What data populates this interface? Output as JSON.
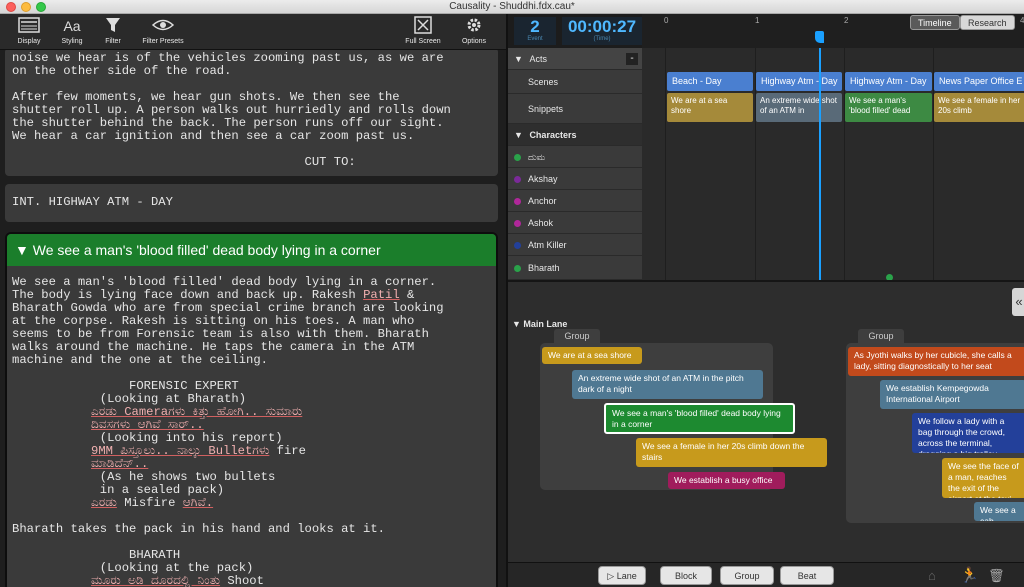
{
  "window": {
    "title": "Causality - Shuddhi.fdx.cau*"
  },
  "toolbar": {
    "display": "Display",
    "styling": "Styling",
    "styling_icon_glyph": "Aa",
    "filter": "Filter",
    "filter_presets": "Filter Presets",
    "full_screen": "Full Screen",
    "options": "Options"
  },
  "script": {
    "card1_lines": [
      "noise we hear is of the vehicles zooming past us, as we are",
      "on the other side of the road.",
      "",
      "After few moments, we hear gun shots. We then see the",
      "shutter roll up. A person walks out hurriedly and rolls down",
      "the shutter behind the back. The person runs off our sight.",
      "We hear a car ignition and then see a car zoom past us.",
      "",
      "                                        CUT TO:"
    ],
    "scene_heading": "INT. HIGHWAY ATM - DAY",
    "active_beat_title": "We see a man's 'blood filled' dead body lying in a corner",
    "active_lines_a": [
      "We see a man's 'blood filled' dead body lying in a corner.",
      "The body is lying face down and back up. Rakesh "
    ],
    "active_name_patil": "Patil",
    "active_lines_b_suffix": " &",
    "active_lines_c": [
      "Bharath Gowda who are from special crime branch are looking",
      "at the corpse. Rakesh is sitting on his toes. A man who",
      "seems to be from Forensic team is also with them. Bharath",
      "walks around the machine. He taps the camera in the ATM",
      "machine and the one at the ceiling.",
      "",
      "                FORENSIC EXPERT",
      "            (Looking at Bharath)"
    ],
    "dialog1": "ಎರಡು Cameraಗಳು ಕಿತ್ತು ಹೋಗಿ.. ಸುಮಾರು",
    "dialog2": "ದಿವಸಗಳು ಆಗಿವೆ ಸಾರ್..",
    "paren2": "            (Looking into his report)",
    "dialog3a": "9MM ಪಿಸ್ತೂಲು.. ನಾಲ್ಕು Bulletಗಳು",
    "dialog3b": " fire",
    "dialog4": "ಮಾಡಿದೆನ್..",
    "paren3": "            (As he shows two bullets",
    "paren4": "            in a sealed pack)",
    "dialog5a": "ಎರಡು",
    "dialog5b": " Misfire ",
    "dialog5c": "ಆಗಿವೆ.",
    "action2": "Bharath takes the pack in his hand and looks at it.",
    "char2": "                BHARATH",
    "paren5": "            (Looking at the pack)",
    "dialog6a": "ಮೂರು ಅಡಿ ದೂರದಲ್ಲಿ ನಿಂತು",
    "dialog6b": " Shoot"
  },
  "timeline": {
    "event_count": "2",
    "event_label": "Event",
    "time": "00:00:27",
    "time_label": "(Time)",
    "ticks": [
      "0",
      "1",
      "2",
      "4"
    ],
    "tabs": [
      "Timeline",
      "Research"
    ],
    "active_tab": "Research",
    "tracks": {
      "acts": "Acts",
      "acts_collapse": "-",
      "scenes": "Scenes",
      "snippets": "Snippets",
      "characters": "Characters"
    },
    "characters": [
      {
        "name": "ದುಮ",
        "color": "#2aa24a"
      },
      {
        "name": "Akshay",
        "color": "#7b2a99"
      },
      {
        "name": "Anchor",
        "color": "#b0279a"
      },
      {
        "name": "Ashok",
        "color": "#b0279a"
      },
      {
        "name": "Atm Killer",
        "color": "#23409a"
      },
      {
        "name": "Bharath",
        "color": "#2aa24a"
      }
    ],
    "scenes": [
      {
        "label": "Beach - Day",
        "color": "#4a7fd0"
      },
      {
        "label": "Highway Atm - Day",
        "color": "#4a7fd0"
      },
      {
        "label": "Highway Atm - Day",
        "color": "#4a7fd0"
      },
      {
        "label": "News Paper Office E",
        "color": "#4a7fd0"
      }
    ],
    "snippets": [
      {
        "text": "We are at a sea shore",
        "color": "#a58a3a"
      },
      {
        "text": "An extreme wide shot of an ATM in",
        "color": "#596a78"
      },
      {
        "text": "We see a man's 'blood filled' dead",
        "color": "#3d8a43"
      },
      {
        "text": "We see a female in her 20s climb",
        "color": "#a58a3a"
      }
    ]
  },
  "main_lane": {
    "label": "Main Lane",
    "group1_label": "Group",
    "group2_label": "Group",
    "group1_beats": [
      {
        "text": "We are at a sea shore",
        "color": "#c79a1c"
      },
      {
        "text": "An extreme wide shot of an ATM in the pitch dark of a night",
        "color": "#4f7892"
      },
      {
        "text": "We see a man's 'blood filled' dead body lying in a corner",
        "color": "#1d8a30"
      },
      {
        "text": "We see a female in her 20s climb down the stairs",
        "color": "#c79a1c"
      },
      {
        "text": "We establish a busy office",
        "color": "#a01c5c"
      }
    ],
    "group2_beats": [
      {
        "text": "As Jyothi walks by her cubicle, she calls a lady, sitting diagnostically to her seat",
        "color": "#c24a1c"
      },
      {
        "text": "We establish Kempegowda International Airport",
        "color": "#4f7892"
      },
      {
        "text": "We follow a lady with a bag through the crowd, across the terminal, dragging a big trolley",
        "color": "#23409a"
      },
      {
        "text": "We see the face of a man, reaches the exit of the airport at the taxi stand",
        "color": "#c79a1c"
      },
      {
        "text": "We see a cab",
        "color": "#4f7892"
      }
    ],
    "collapse_glyph": "«"
  },
  "bottom": {
    "lane": "Lane",
    "block": "Block",
    "group": "Group",
    "beat": "Beat"
  }
}
